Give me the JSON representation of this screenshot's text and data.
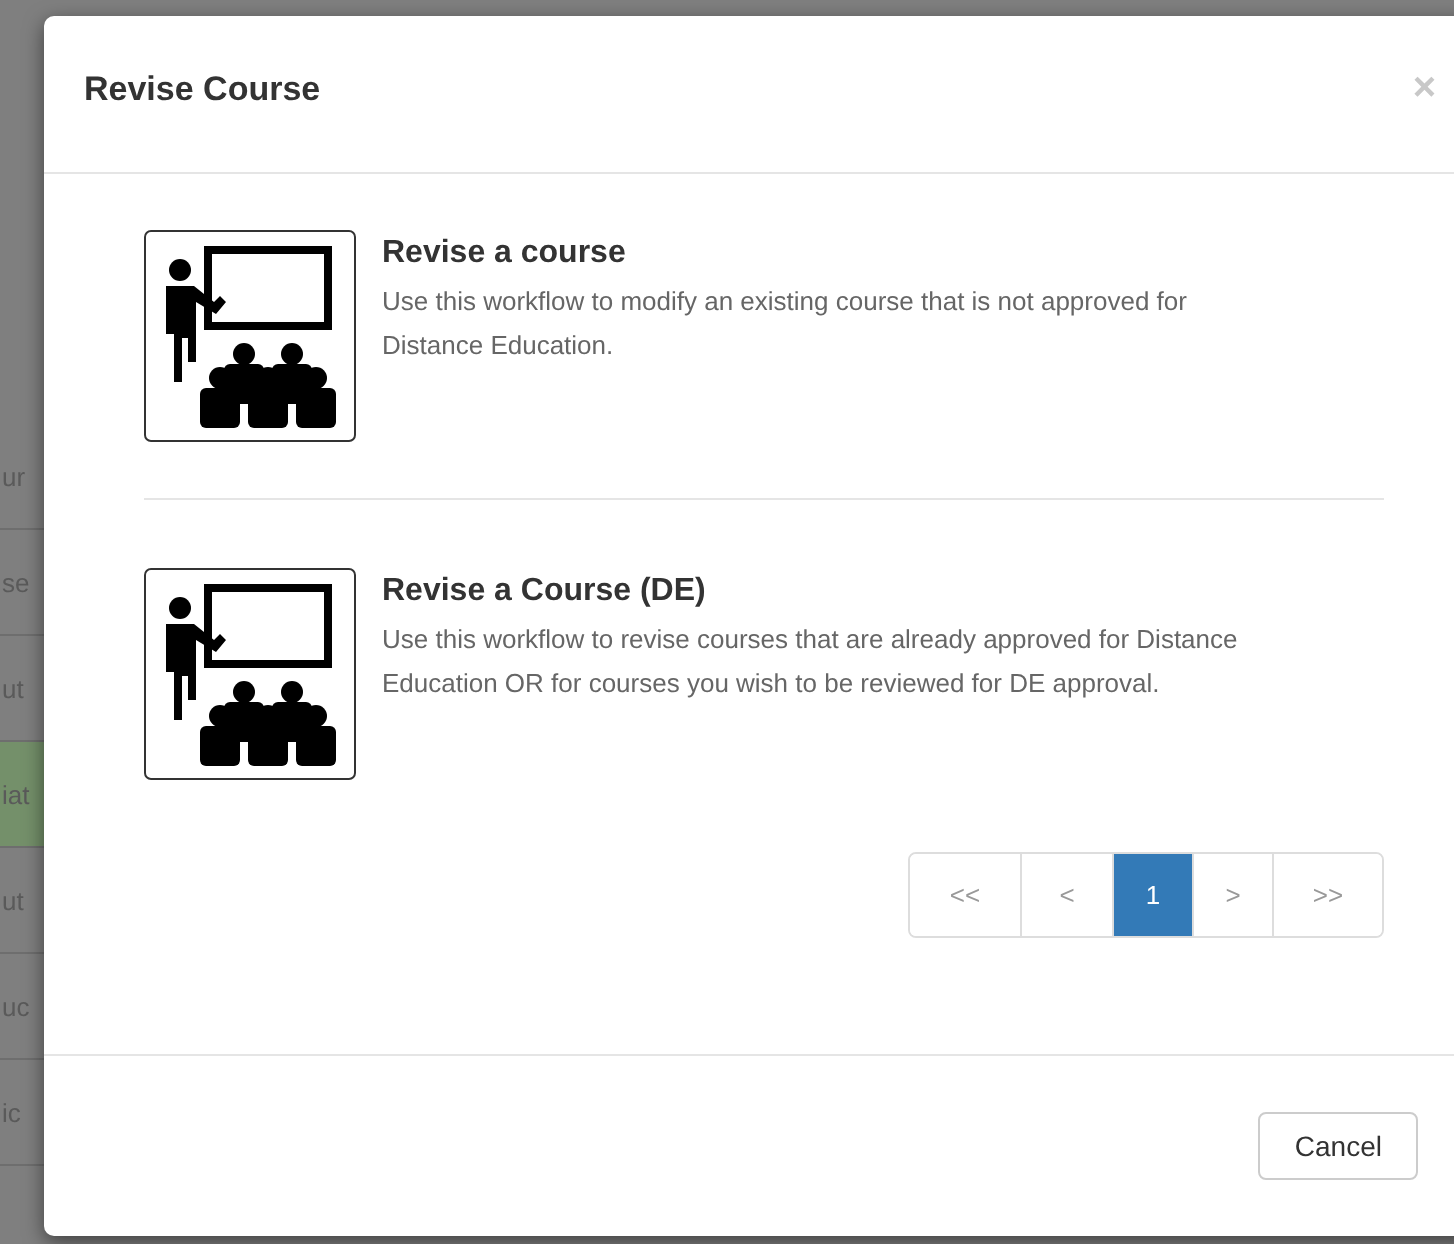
{
  "background_rows": [
    {
      "text": "ur",
      "highlighted": false
    },
    {
      "text": "se",
      "highlighted": false
    },
    {
      "text": "ut",
      "highlighted": false
    },
    {
      "text": "iat",
      "highlighted": true
    },
    {
      "text": "ut",
      "highlighted": false
    },
    {
      "text": "uc",
      "highlighted": false
    },
    {
      "text": "ic",
      "highlighted": false
    }
  ],
  "modal": {
    "title": "Revise Course",
    "close": "×",
    "options": [
      {
        "title": "Revise a course",
        "description": "Use this workflow to modify an existing course that is not approved for Distance Education."
      },
      {
        "title": "Revise a Course (DE)",
        "description": "Use this workflow to revise courses that are already approved for Distance Education OR for courses you wish to be reviewed for DE approval."
      }
    ],
    "pagination": [
      {
        "label": "<<",
        "selected": false
      },
      {
        "label": "<",
        "selected": false
      },
      {
        "label": "1",
        "selected": true
      },
      {
        "label": ">",
        "selected": false
      },
      {
        "label": ">>",
        "selected": false
      }
    ],
    "buttons": [
      "Cancel"
    ]
  }
}
